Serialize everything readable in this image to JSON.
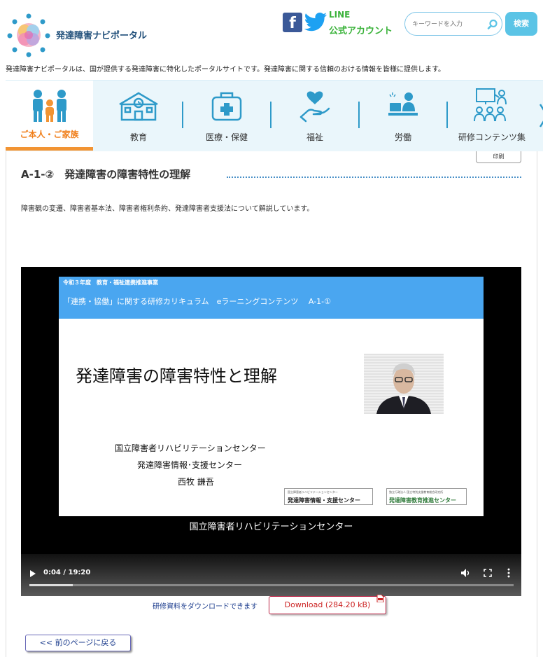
{
  "header": {
    "site_name": "発達障害ナビポータル",
    "line_label": "LINE",
    "line_account": "公式アカウント",
    "search_placeholder": "キーワードを入力",
    "search_button": "検索",
    "tagline": "発達障害ナビポータルは、国が提供する発達障害に特化したポータルサイトです。発達障害に関する信頼のおける情報を皆様に提供します。"
  },
  "nav": {
    "items": [
      {
        "label": "ご本人・ご家族",
        "icon": "family-icon",
        "active": true
      },
      {
        "label": "教育",
        "icon": "school-icon",
        "active": false
      },
      {
        "label": "医療・保健",
        "icon": "medical-kit-icon",
        "active": false
      },
      {
        "label": "福祉",
        "icon": "heart-hand-icon",
        "active": false
      },
      {
        "label": "労働",
        "icon": "worker-icon",
        "active": false
      },
      {
        "label": "研修コンテンツ集",
        "icon": "training-icon",
        "active": false
      }
    ]
  },
  "page": {
    "print_label": "印刷",
    "title": "A-1-②　発達障害の障害特性の理解",
    "description": "障害観の変遷、障害者基本法、障害者権利条約、発達障害者支援法について解説しています。"
  },
  "video": {
    "slide_year": "令和３年度　教育・福祉連携推進事業",
    "slide_curriculum": "「連携・協働」に関する研修カリキュラム　eラーニングコンテンツ　 A-1-①",
    "slide_title": "発達障害の障害特性と理解",
    "slide_org1": "国立障害者リハビリテーションセンター",
    "slide_org2": "発達障害情報･支援センター",
    "slide_name": "西牧  謙吾",
    "logo1_small": "国立障害者リハビリテーションセンター",
    "logo1_big": "発達障害情報・支援センター",
    "logo2_small": "独立行政法人 国立特別支援教育総合研究所",
    "logo2_big": "発達障害教育推進センター",
    "caption": "国立障害者リハビリテーションセンター",
    "time": "0:04 / 19:20",
    "progress": 0.0035
  },
  "download": {
    "note": "研修資料をダウンロードできます",
    "button": "Download (284.20 kB)"
  },
  "back_button": "<< 前のページに戻る",
  "colors": {
    "accent": "#5bc4e6",
    "active_tab": "#f29433",
    "nav_bg": "#eaf6fb",
    "icon_blue": "#2e9ac9"
  }
}
